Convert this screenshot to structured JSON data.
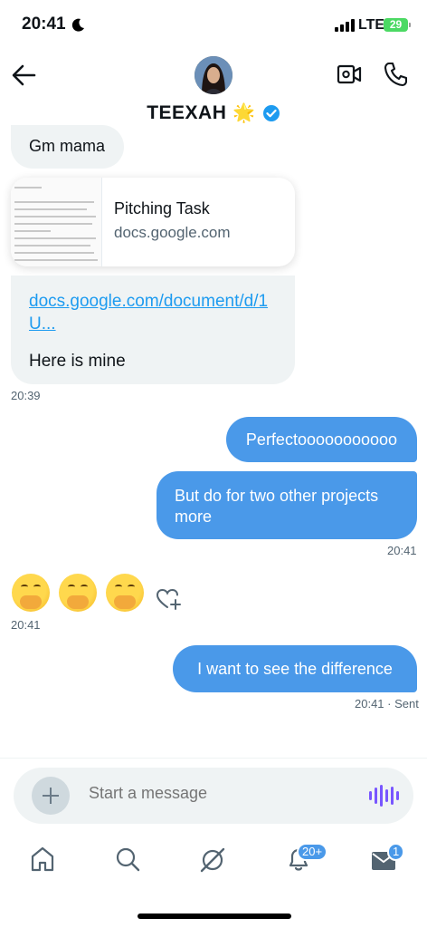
{
  "status_bar": {
    "time": "20:41",
    "network": "LTE",
    "battery": "29"
  },
  "header": {
    "contact_name": "TEEXAH",
    "name_emoji": "🌟",
    "back_icon": "arrow-left-icon",
    "video_icon": "video-call-icon",
    "phone_icon": "phone-icon"
  },
  "messages": {
    "gm": "Gm mama",
    "link_card": {
      "title": "Pitching Task",
      "domain": "docs.google.com"
    },
    "link_text": "docs.google.com/document/d/1 U...",
    "here_is_mine": "Here is mine",
    "ts_1": "20:39",
    "perfecto": "Perfectooooooooooo",
    "but_do": "But do for two other projects more",
    "ts_2": "20:41",
    "ts_3": "20:41",
    "i_want": "I want to see the difference",
    "ts_4": "20:41 · Sent"
  },
  "composer": {
    "placeholder": "Start a message"
  },
  "nav": {
    "notifications_badge": "20+",
    "messages_badge": "1"
  },
  "colors": {
    "accent": "#4a99e9",
    "link": "#1d9bf0",
    "voice": "#7856ff"
  }
}
